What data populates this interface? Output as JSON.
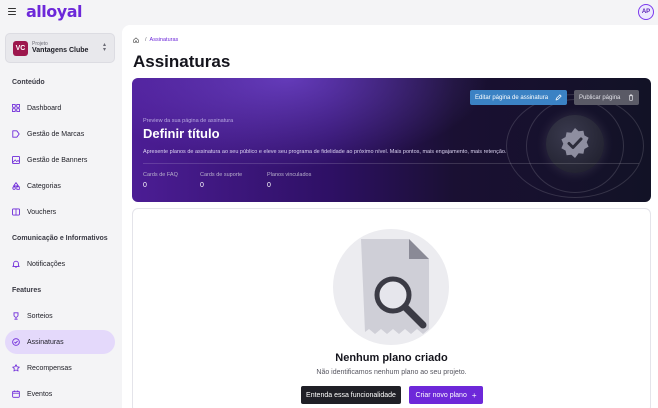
{
  "app": {
    "logo": "alloyal",
    "avatar_initials": "AP"
  },
  "project": {
    "kicker": "Projeto",
    "name": "Vantagens Clube",
    "logo_letters": "VC"
  },
  "sidebar": {
    "sections": [
      {
        "title": "Conteúdo"
      },
      {
        "title": "Comunicação e Informativos"
      },
      {
        "title": "Features"
      }
    ],
    "items": [
      {
        "label": "Dashboard",
        "icon": "grid-icon"
      },
      {
        "label": "Gestão de Marcas",
        "icon": "tag-icon"
      },
      {
        "label": "Gestão de Banners",
        "icon": "image-icon"
      },
      {
        "label": "Categorias",
        "icon": "shapes-icon"
      },
      {
        "label": "Vouchers",
        "icon": "ticket-icon"
      },
      {
        "label": "Notificações",
        "icon": "bell-icon"
      },
      {
        "label": "Sorteios",
        "icon": "trophy-icon"
      },
      {
        "label": "Assinaturas",
        "icon": "badge-check-icon",
        "active": true
      },
      {
        "label": "Recompensas",
        "icon": "star-icon"
      },
      {
        "label": "Eventos",
        "icon": "calendar-icon"
      }
    ]
  },
  "breadcrumb": {
    "current": "Assinaturas"
  },
  "page": {
    "title": "Assinaturas"
  },
  "hero": {
    "edit_label": "Editar página de assinatura",
    "publish_label": "Publicar página",
    "kicker": "Preview da sua página de assinatura",
    "title": "Definir título",
    "description": "Apresente planos de assinatura ao seu público e eleve seu programa de fidelidade ao próximo nível. Mais pontos, mais engajamento, mais retenção.",
    "stats": [
      {
        "label": "Cards de FAQ",
        "value": "0"
      },
      {
        "label": "Cards de suporte",
        "value": "0"
      },
      {
        "label": "Planos vinculados",
        "value": "0"
      }
    ]
  },
  "empty_state": {
    "title": "Nenhum plano criado",
    "description": "Não identificamos nenhum plano ao seu projeto.",
    "learn_label": "Entenda essa funcionalidade",
    "create_label": "Criar novo plano"
  },
  "colors": {
    "accent": "#6d28d9",
    "active_bg": "#e4d9fb",
    "edit_button": "#3b82c4"
  }
}
